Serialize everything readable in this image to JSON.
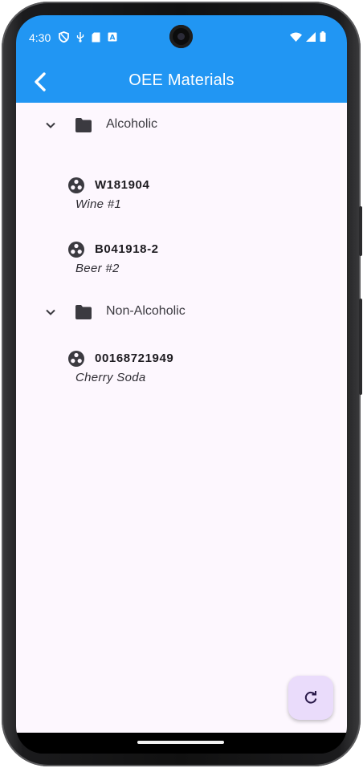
{
  "status_bar": {
    "time": "4:30",
    "left_icons": [
      "shield-icon",
      "usb-icon",
      "sd-card-icon",
      "keyboard-icon"
    ],
    "right_icons": [
      "wifi-icon",
      "signal-icon",
      "battery-icon"
    ]
  },
  "app_bar": {
    "title": "OEE Materials",
    "back_icon": "chevron-left-icon",
    "background": "#2196f3"
  },
  "groups": [
    {
      "label": "Alcoholic",
      "expanded": true,
      "items": [
        {
          "code": "W181904",
          "description": "Wine #1"
        },
        {
          "code": "B041918-2",
          "description": "Beer #2"
        }
      ]
    },
    {
      "label": "Non-Alcoholic",
      "expanded": true,
      "items": [
        {
          "code": "00168721949",
          "description": "Cherry Soda"
        }
      ]
    }
  ],
  "fab": {
    "icon": "refresh-icon",
    "background": "#eadcfb"
  },
  "colors": {
    "accent": "#2196f3",
    "content_bg": "#fdf7fe"
  }
}
